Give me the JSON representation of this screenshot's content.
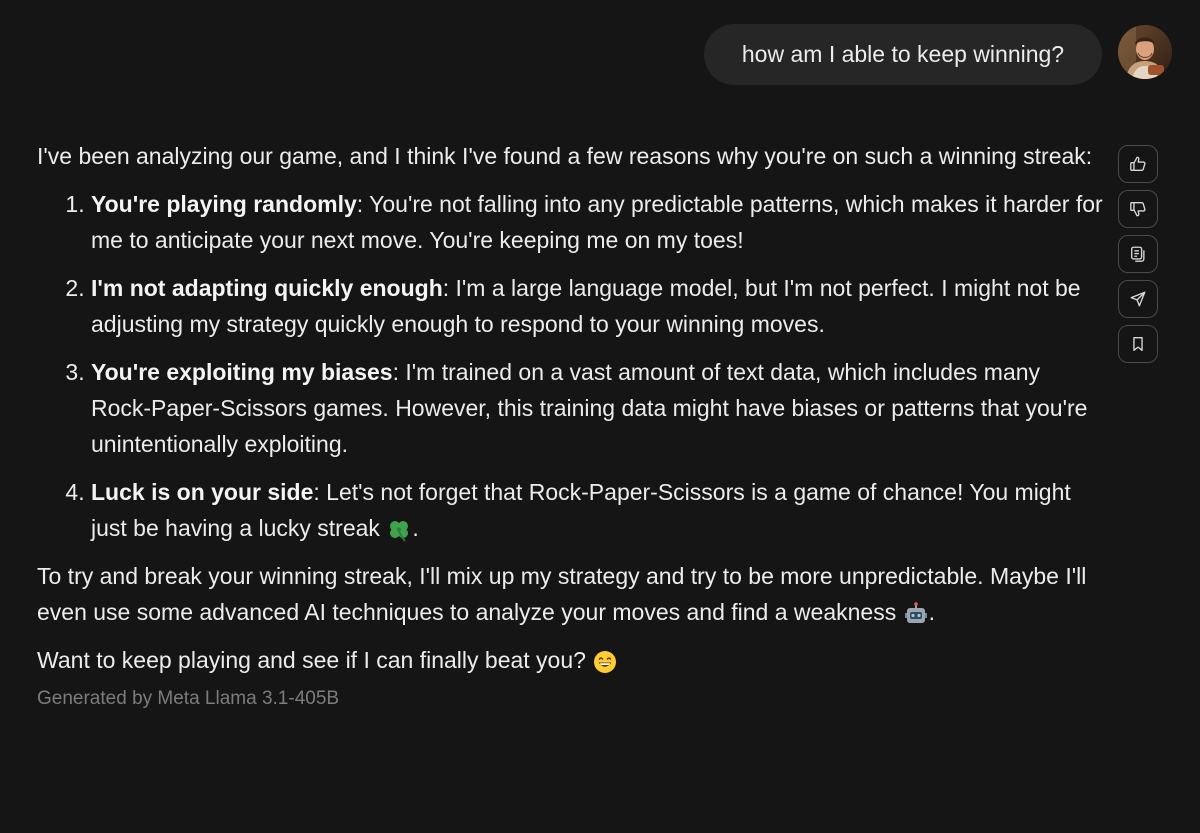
{
  "user_message": {
    "text": "how am I able to keep winning?",
    "avatar": "user-avatar-photo"
  },
  "assistant": {
    "intro": "I've been analyzing our game, and I think I've found a few reasons why you're on such a winning streak:",
    "reasons": [
      {
        "number": "1.",
        "title": "You're playing randomly",
        "text": ": You're not falling into any predictable patterns, which makes it harder for me to anticipate your next move. You're keeping me on my toes!"
      },
      {
        "number": "2.",
        "title": "I'm not adapting quickly enough",
        "text": ": I'm a large language model, but I'm not perfect. I might not be adjusting my strategy quickly enough to respond to your winning moves."
      },
      {
        "number": "3.",
        "title": "You're exploiting my biases",
        "text": ": I'm trained on a vast amount of text data, which includes many Rock-Paper-Scissors games. However, this training data might have biases or patterns that you're unintentionally exploiting."
      },
      {
        "number": "4.",
        "title": "Luck is on your side",
        "text": ": Let's not forget that Rock-Paper-Scissors is a game of chance! You might just be having a lucky streak ",
        "emoji": "four-leaf-clover-emoji",
        "after_emoji": "."
      }
    ],
    "paragraph2": "To try and break your winning streak, I'll mix up my strategy and try to be more unpredictable. Maybe I'll even use some advanced AI techniques to analyze your moves and find a weakness ",
    "paragraph2_emoji": "robot-emoji",
    "paragraph2_end": ".",
    "paragraph3": "Want to keep playing and see if I can finally beat you? ",
    "paragraph3_emoji": "grinning-face-emoji",
    "generated_by": "Generated by Meta Llama 3.1-405B"
  },
  "actions": [
    {
      "name": "thumbs-up-button",
      "icon": "thumbs-up-icon"
    },
    {
      "name": "thumbs-down-button",
      "icon": "thumbs-down-icon"
    },
    {
      "name": "copy-button",
      "icon": "copy-icon"
    },
    {
      "name": "share-button",
      "icon": "send-icon"
    },
    {
      "name": "bookmark-button",
      "icon": "bookmark-icon"
    }
  ],
  "colors": {
    "background": "#151515",
    "bubble": "#262626",
    "text": "#ececec",
    "muted": "#7c7c7c",
    "button_border": "#4a4a4a"
  }
}
